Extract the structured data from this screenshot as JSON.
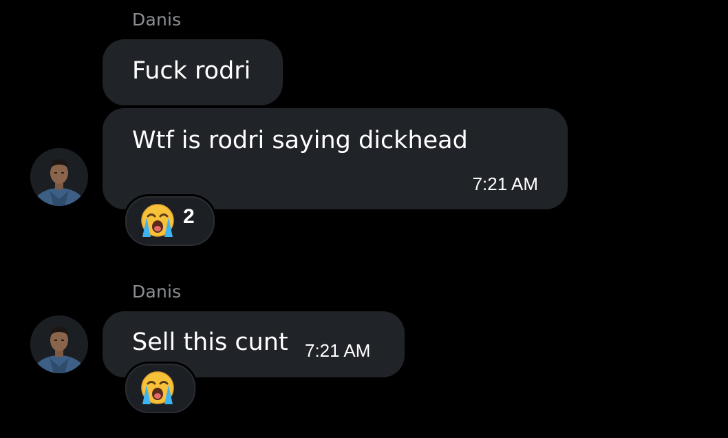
{
  "messages": [
    {
      "sender": "Danis",
      "text": "Fuck rodri"
    },
    {
      "text": "Wtf is rodri saying dickhead",
      "time": "7:21 AM",
      "reaction": {
        "emoji": "loudly-crying-face",
        "count": "2"
      }
    },
    {
      "sender": "Danis",
      "text": "Sell this cunt",
      "time": "7:21 AM",
      "reaction": {
        "emoji": "loudly-crying-face"
      }
    }
  ],
  "colors": {
    "background": "#000000",
    "bubble": "#202327",
    "sender_name": "#8b8f94",
    "text": "#ffffff"
  }
}
